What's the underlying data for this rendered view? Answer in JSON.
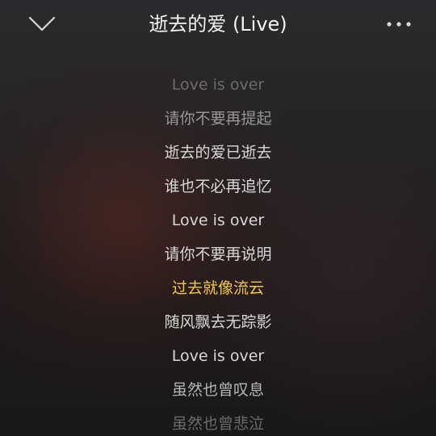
{
  "header": {
    "title": "逝去的爱 (Live)",
    "collapse_icon": "chevron-down-icon",
    "more_icon": "more-horizontal-icon"
  },
  "lyrics": {
    "current_index": 6,
    "highlight_color": "#f2c84b",
    "lines": [
      "Love is over",
      "请你不要再提起",
      "逝去的爱已逝去",
      "谁也不必再追忆",
      "Love is over",
      "请你不要再说明",
      "过去就像流云",
      "随风飘去无踪影",
      "Love is over",
      "虽然也曾叹息",
      "虽然也曾悲泣"
    ]
  }
}
